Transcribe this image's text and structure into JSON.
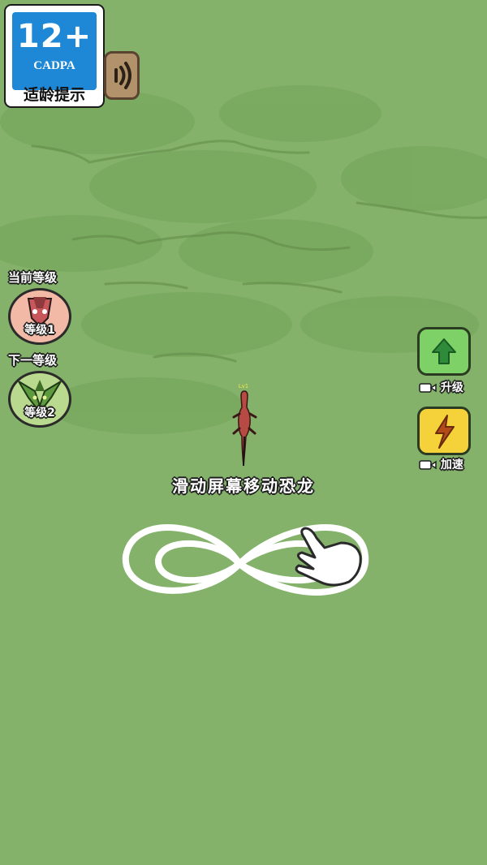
{
  "rating_badge": {
    "age": "12+",
    "org": "CADPA",
    "tip": "适龄提示"
  },
  "icons": {
    "sound": "speaker-icon",
    "upgrade": "up-arrow-icon",
    "speed": "lightning-icon",
    "video": "video-camera-icon",
    "gesture": "pointing-hand-icon"
  },
  "current_level": {
    "heading": "当前等级",
    "label": "等级1"
  },
  "next_level": {
    "heading": "下一等级",
    "label": "等级2"
  },
  "player": {
    "level_tag": "Lv1"
  },
  "upgrade_button": {
    "label": "升级"
  },
  "speed_button": {
    "label": "加速"
  },
  "tutorial": {
    "hint": "滑动屏幕移动恐龙"
  },
  "colors": {
    "ground": "#84b26a",
    "upgrade_button": "#7ed166",
    "speed_button": "#f5d23a",
    "rating_blue": "#1e88d6",
    "dino_current": "#c7575a",
    "dino_next": "#5e9a3e"
  }
}
